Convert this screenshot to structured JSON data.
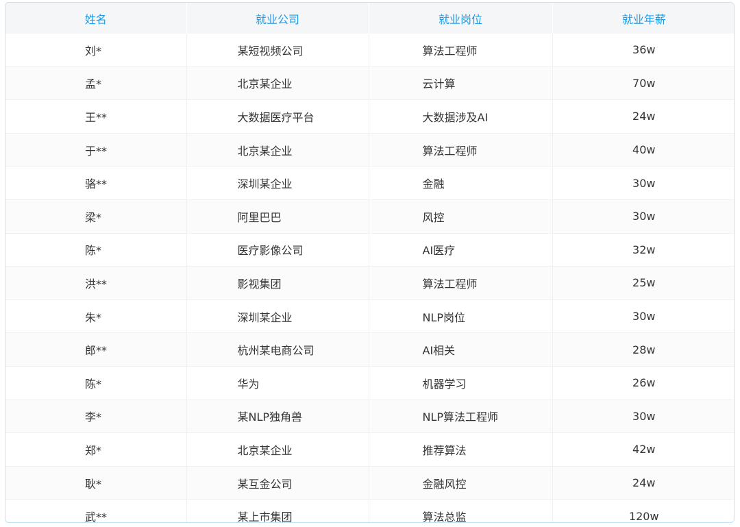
{
  "table": {
    "headers": [
      "姓名",
      "就业公司",
      "就业岗位",
      "就业年薪"
    ],
    "rows": [
      {
        "name": "刘*",
        "company": "某短视频公司",
        "position": "算法工程师",
        "salary": "36w"
      },
      {
        "name": "孟*",
        "company": "北京某企业",
        "position": "云计算",
        "salary": "70w"
      },
      {
        "name": "王**",
        "company": "大数据医疗平台",
        "position": "大数据涉及AI",
        "salary": "24w"
      },
      {
        "name": "于**",
        "company": "北京某企业",
        "position": "算法工程师",
        "salary": "40w"
      },
      {
        "name": "骆**",
        "company": "深圳某企业",
        "position": "金融",
        "salary": "30w"
      },
      {
        "name": "梁*",
        "company": "阿里巴巴",
        "position": "风控",
        "salary": "30w"
      },
      {
        "name": "陈*",
        "company": "医疗影像公司",
        "position": "AI医疗",
        "salary": "32w"
      },
      {
        "name": "洪**",
        "company": "影视集团",
        "position": "算法工程师",
        "salary": "25w"
      },
      {
        "name": "朱*",
        "company": "深圳某企业",
        "position": "NLP岗位",
        "salary": "30w"
      },
      {
        "name": "郎**",
        "company": "杭州某电商公司",
        "position": "AI相关",
        "salary": "28w"
      },
      {
        "name": "陈*",
        "company": "华为",
        "position": "机器学习",
        "salary": "26w"
      },
      {
        "name": "李*",
        "company": "某NLP独角兽",
        "position": "NLP算法工程师",
        "salary": "30w"
      },
      {
        "name": "郑*",
        "company": "北京某企业",
        "position": "推荐算法",
        "salary": "42w"
      },
      {
        "name": "耿*",
        "company": "某互金公司",
        "position": "金融风控",
        "salary": "24w"
      },
      {
        "name": "武**",
        "company": "某上市集团",
        "position": "算法总监",
        "salary": "120w"
      }
    ]
  }
}
